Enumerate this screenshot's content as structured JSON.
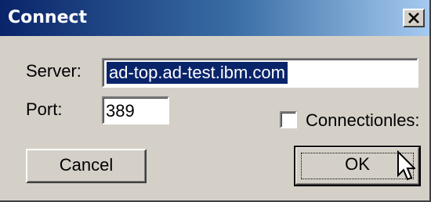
{
  "dialog": {
    "title": "Connect",
    "close_icon": "close-icon"
  },
  "form": {
    "server_label": "Server:",
    "server_value": "ad-top.ad-test.ibm.com",
    "port_label": "Port:",
    "port_value": "389",
    "connectionless_label": "Connectionles:",
    "connectionless_checked": false
  },
  "buttons": {
    "cancel_label": "Cancel",
    "ok_label": "OK"
  },
  "colors": {
    "title_gradient_start": "#0a246a",
    "title_gradient_end": "#a6caf0",
    "dialog_face": "#d4d0c8",
    "selection": "#0a246a"
  },
  "pointer": "arrow-cursor-icon"
}
